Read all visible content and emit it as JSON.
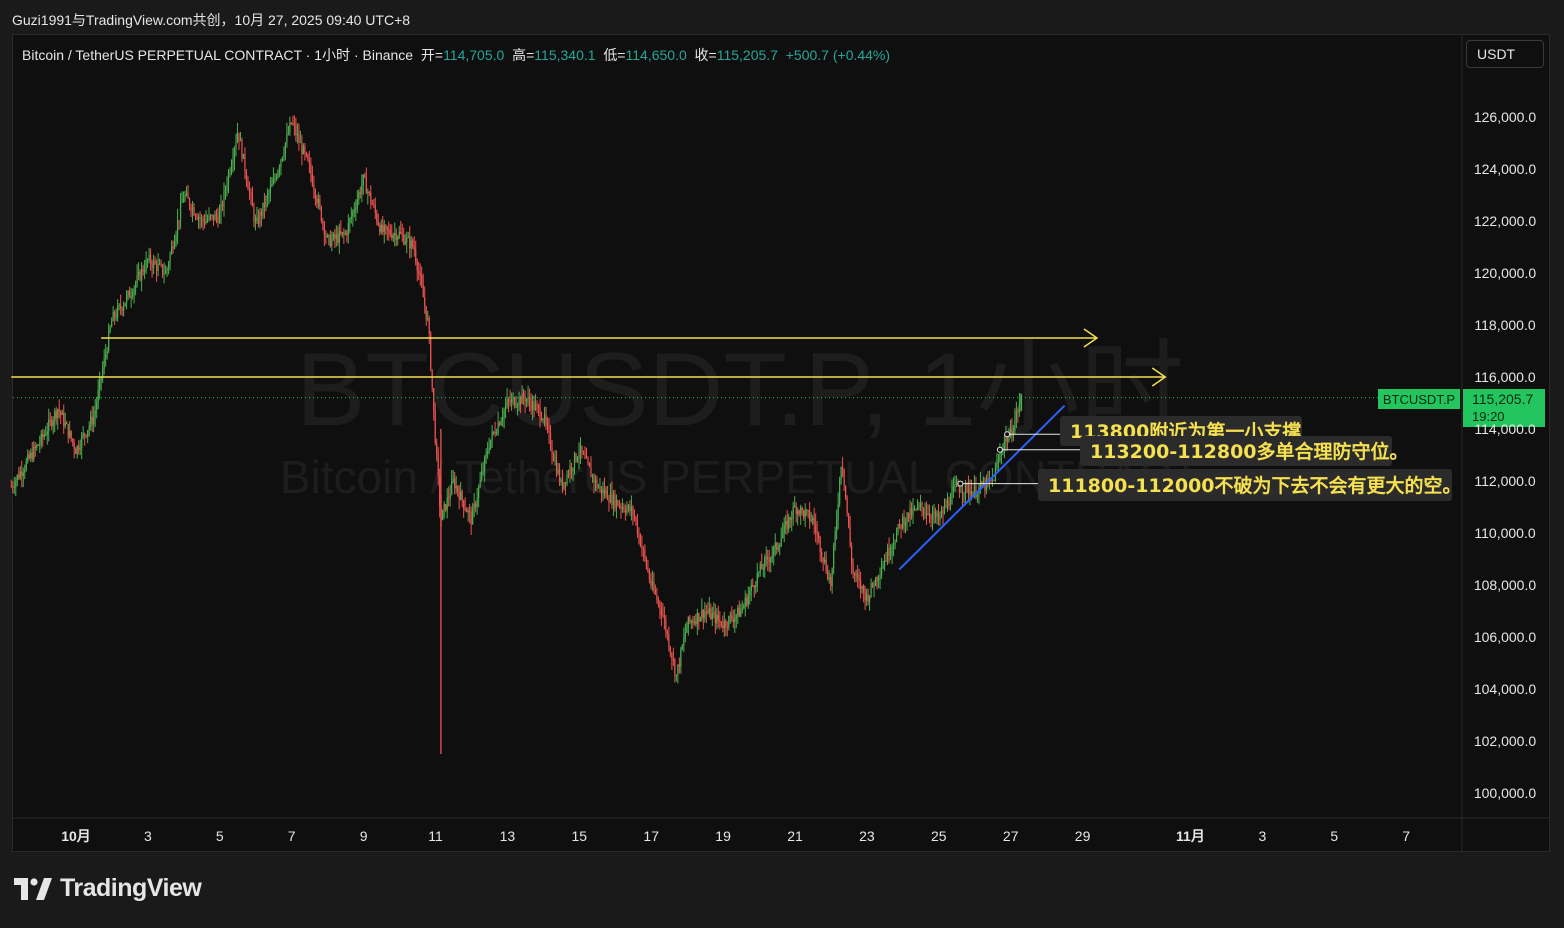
{
  "caption": "Guzi1991与TradingView.com共创，10月 27, 2025 09:40 UTC+8",
  "legend": {
    "symbol": "Bitcoin / TetherUS PERPETUAL CONTRACT · 1小时 · Binance",
    "open_label": "开=",
    "open": "114,705.0",
    "high_label": "高=",
    "high": "115,340.1",
    "low_label": "低=",
    "low": "114,650.0",
    "close_label": "收=",
    "close": "115,205.7",
    "change": "+500.7 (+0.44%)"
  },
  "currency_button": "USDT",
  "watermark": {
    "line1": "BTCUSDT.P, 1小时",
    "line2": "Bitcoin / TetherUS PERPETUAL CONTRACT"
  },
  "brand": "TradingView",
  "price_tag": {
    "symbol": "BTCUSDT.P",
    "price": "115,205.7",
    "countdown": "19:20"
  },
  "colors": {
    "up": "#26a69a",
    "up_candle": "#4caf50",
    "down": "#ef5350",
    "accent": "#f5e050",
    "trend": "#2962ff",
    "tag": "#22c55e"
  },
  "chart_data": {
    "type": "candlestick",
    "ylim": [
      99000,
      127000
    ],
    "y_ticks": [
      100000,
      102000,
      104000,
      106000,
      108000,
      110000,
      112000,
      114000,
      116000,
      118000,
      120000,
      122000,
      124000,
      126000
    ],
    "y_tick_labels": [
      "100,000.0",
      "102,000.0",
      "104,000.0",
      "106,000.0",
      "108,000.0",
      "110,000.0",
      "112,000.0",
      "114,000.0",
      "116,000.0",
      "118,000.0",
      "120,000.0",
      "122,000.0",
      "124,000.0",
      "126,000.0"
    ],
    "x_ticks": [
      {
        "day": 1,
        "label": "10月"
      },
      {
        "day": 3,
        "label": "3"
      },
      {
        "day": 5,
        "label": "5"
      },
      {
        "day": 7,
        "label": "7"
      },
      {
        "day": 9,
        "label": "9"
      },
      {
        "day": 11,
        "label": "11"
      },
      {
        "day": 13,
        "label": "13"
      },
      {
        "day": 15,
        "label": "15"
      },
      {
        "day": 17,
        "label": "17"
      },
      {
        "day": 19,
        "label": "19"
      },
      {
        "day": 21,
        "label": "21"
      },
      {
        "day": 23,
        "label": "23"
      },
      {
        "day": 25,
        "label": "25"
      },
      {
        "day": 27,
        "label": "27"
      },
      {
        "day": 29,
        "label": "29"
      },
      {
        "day": 32,
        "label": "11月"
      },
      {
        "day": 34,
        "label": "3"
      },
      {
        "day": 36,
        "label": "5"
      },
      {
        "day": 38,
        "label": "7"
      }
    ],
    "price_path": [
      [
        -0.8,
        111800
      ],
      [
        0.0,
        113500
      ],
      [
        0.5,
        114800
      ],
      [
        1.0,
        113200
      ],
      [
        1.5,
        114500
      ],
      [
        2.0,
        118200
      ],
      [
        2.5,
        119200
      ],
      [
        3.0,
        120500
      ],
      [
        3.5,
        120000
      ],
      [
        4.0,
        123000
      ],
      [
        4.5,
        122000
      ],
      [
        5.0,
        122200
      ],
      [
        5.5,
        125500
      ],
      [
        6.0,
        121800
      ],
      [
        6.5,
        123500
      ],
      [
        7.0,
        125800
      ],
      [
        7.5,
        124000
      ],
      [
        8.0,
        121200
      ],
      [
        8.5,
        121500
      ],
      [
        9.0,
        123600
      ],
      [
        9.5,
        121600
      ],
      [
        10.0,
        121500
      ],
      [
        10.4,
        121000
      ],
      [
        10.8,
        118000
      ],
      [
        11.0,
        113500
      ],
      [
        11.15,
        110500
      ],
      [
        11.5,
        112000
      ],
      [
        12.0,
        110500
      ],
      [
        12.5,
        113500
      ],
      [
        13.0,
        115000
      ],
      [
        13.5,
        115200
      ],
      [
        14.0,
        114500
      ],
      [
        14.5,
        111800
      ],
      [
        15.0,
        113200
      ],
      [
        15.5,
        111800
      ],
      [
        16.0,
        111200
      ],
      [
        16.5,
        110800
      ],
      [
        17.0,
        108000
      ],
      [
        17.3,
        107000
      ],
      [
        17.7,
        104500
      ],
      [
        18.0,
        106500
      ],
      [
        18.5,
        107000
      ],
      [
        19.0,
        106500
      ],
      [
        19.5,
        107000
      ],
      [
        20.0,
        108500
      ],
      [
        20.5,
        109500
      ],
      [
        21.0,
        111000
      ],
      [
        21.5,
        110500
      ],
      [
        22.0,
        108000
      ],
      [
        22.3,
        113000
      ],
      [
        22.6,
        108500
      ],
      [
        23.0,
        107500
      ],
      [
        23.5,
        109000
      ],
      [
        24.0,
        110500
      ],
      [
        24.5,
        111000
      ],
      [
        25.0,
        110500
      ],
      [
        25.5,
        111800
      ],
      [
        26.0,
        111600
      ],
      [
        26.5,
        112000
      ],
      [
        26.8,
        113500
      ],
      [
        27.0,
        113800
      ],
      [
        27.3,
        115205
      ]
    ],
    "spikes": [
      [
        11.15,
        101500,
        114000
      ],
      [
        27.3,
        114700,
        115340
      ]
    ],
    "annotations": {
      "hlines": [
        {
          "y": 117500,
          "x0": 1.7,
          "x1": 29.4
        },
        {
          "y": 116000,
          "x0": -0.8,
          "x1": 31.3
        }
      ],
      "trendline": {
        "x0": 23.9,
        "y0": 108600,
        "x1": 28.5,
        "y1": 114900
      },
      "labels": [
        {
          "text": "113800附近为第一小支撑",
          "y": 113800,
          "anchor_x": 26.9
        },
        {
          "text": "113200-112800多单合理防守位。",
          "y": 113200,
          "anchor_x": 26.7
        },
        {
          "text": "111800-112000不破为下去不会有更大的空。",
          "y": 111900,
          "anchor_x": 25.6
        }
      ]
    }
  }
}
